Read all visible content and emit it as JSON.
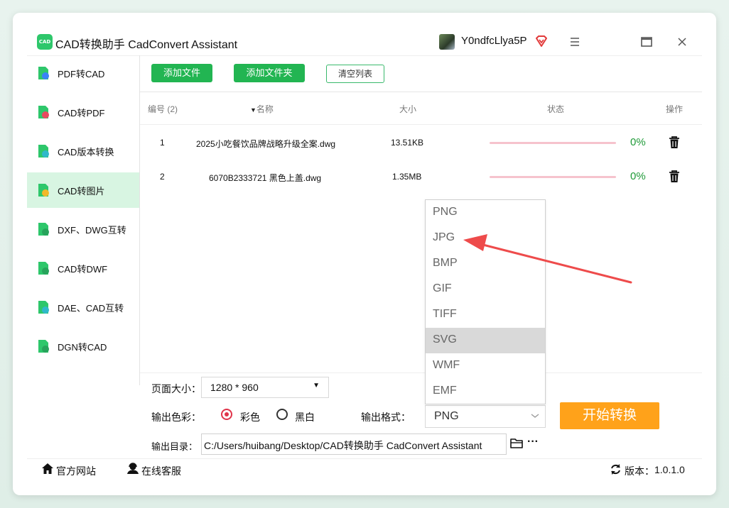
{
  "app": {
    "title": "CAD转换助手 CadConvert Assistant",
    "logo_text": "CAD",
    "username": "Y0ndfcLlya5P"
  },
  "colors": {
    "accent_green": "#22b552",
    "active_bg": "#d8f5e2",
    "progress_pink": "#f6c3cd",
    "percent_green": "#1e9a37",
    "start_orange": "#ffa21a",
    "arrow_red": "#ee4b4b"
  },
  "sidebar": {
    "items": [
      {
        "label": "PDF转CAD",
        "icon": "pdf-file-icon",
        "active": false
      },
      {
        "label": "CAD转PDF",
        "icon": "cad-file-icon",
        "active": false
      },
      {
        "label": "CAD版本转换",
        "icon": "version-file-icon",
        "active": false
      },
      {
        "label": "CAD转图片",
        "icon": "image-file-icon",
        "active": true
      },
      {
        "label": "DXF、DWG互转",
        "icon": "dxf-file-icon",
        "active": false
      },
      {
        "label": "CAD转DWF",
        "icon": "dwf-file-icon",
        "active": false
      },
      {
        "label": "DAE、CAD互转",
        "icon": "dae-file-icon",
        "active": false
      },
      {
        "label": "DGN转CAD",
        "icon": "dgn-file-icon",
        "active": false
      }
    ]
  },
  "toolbar": {
    "add_file": "添加文件",
    "add_folder": "添加文件夹",
    "clear_list": "清空列表"
  },
  "table": {
    "headers": {
      "index": "编号 (2)",
      "name": "名称",
      "size": "大小",
      "status": "状态",
      "action": "操作"
    },
    "rows": [
      {
        "index": "1",
        "name": "2025小吃餐饮品牌战略升级全案.dwg",
        "size": "13.51KB",
        "progress": 0,
        "percent": "0%"
      },
      {
        "index": "2",
        "name": "6070B2333721 黑色上盖.dwg",
        "size": "1.35MB",
        "progress": 0,
        "percent": "0%"
      }
    ]
  },
  "settings": {
    "page_size_label": "页面大小：",
    "page_size_value": "1280 * 960",
    "color_label": "输出色彩：",
    "color_option": "彩色",
    "bw_option": "黑白",
    "color_selected": "彩色",
    "format_label": "输出格式：",
    "format_value": "PNG",
    "format_options": [
      "PNG",
      "JPG",
      "BMP",
      "GIF",
      "TIFF",
      "SVG",
      "WMF",
      "EMF"
    ],
    "format_highlighted": "SVG",
    "dir_label": "输出目录：",
    "dir_value": "C:/Users/huibang/Desktop/CAD转换助手 CadConvert Assistant",
    "more": "···"
  },
  "start_button": "开始转换",
  "footer": {
    "website": "官方网站",
    "support": "在线客服",
    "version_label": "版本：",
    "version": "1.0.1.0"
  }
}
